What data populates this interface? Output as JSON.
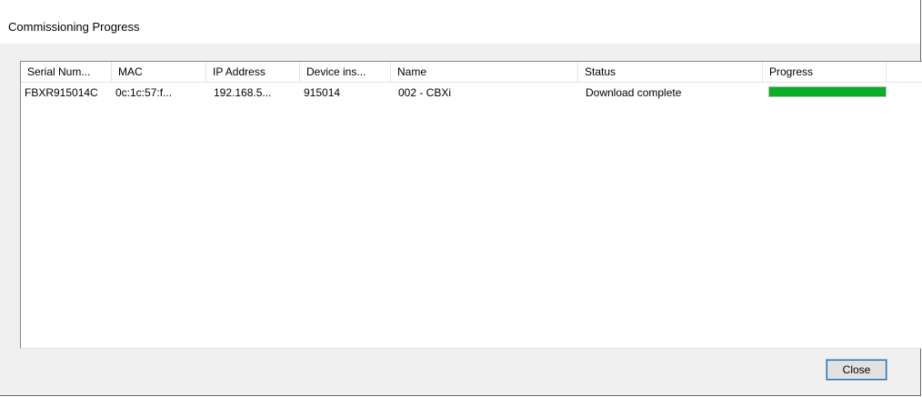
{
  "window": {
    "title": "Commissioning Progress"
  },
  "table": {
    "columns": [
      {
        "label": "Serial Num..."
      },
      {
        "label": "MAC"
      },
      {
        "label": "IP Address"
      },
      {
        "label": "Device ins..."
      },
      {
        "label": "Name"
      },
      {
        "label": "Status"
      },
      {
        "label": "Progress"
      }
    ],
    "rows": [
      {
        "serial": "FBXR915014C",
        "mac": "0c:1c:57:f...",
        "ip": "192.168.5...",
        "device_instance": "915014",
        "name": "002 - CBXi",
        "status": "Download complete",
        "progress_percent": 100
      }
    ]
  },
  "buttons": {
    "close_label": "Close"
  },
  "colors": {
    "progress_fill": "#06b025",
    "focus_outline": "#0078d7"
  }
}
